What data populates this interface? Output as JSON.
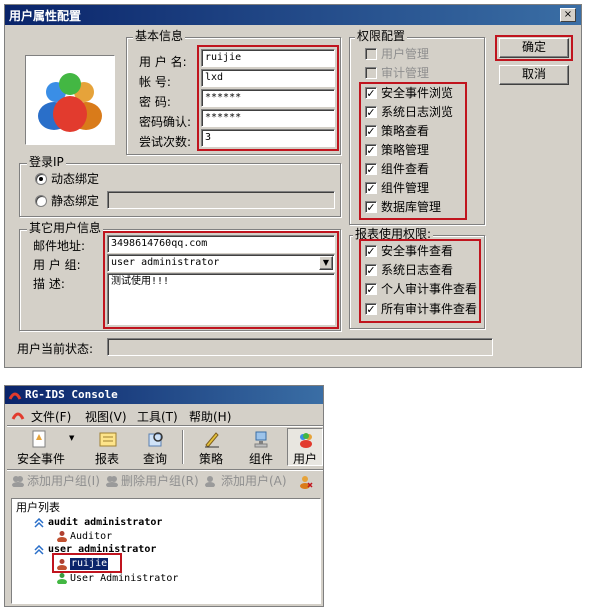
{
  "dialog": {
    "title": "用户属性配置",
    "close": "×",
    "basic_group": "基本信息",
    "fields": [
      {
        "label": "用 户 名:",
        "value": "ruijie"
      },
      {
        "label": "帐    号:",
        "value": "lxd"
      },
      {
        "label": "密    码:",
        "value": "******"
      },
      {
        "label": "密码确认:",
        "value": "******"
      },
      {
        "label": "尝试次数:",
        "value": "3"
      }
    ],
    "login_ip_group": "登录IP",
    "radio_dynamic": "动态绑定",
    "radio_static": "静态绑定",
    "other_group": "其它用户信息",
    "email_label": "邮件地址:",
    "email_value": "3498614760qq.com",
    "usergroup_label": "用 户 组:",
    "usergroup_value": "user administrator",
    "desc_label": "描    述:",
    "desc_value": "测试使用!!!",
    "status_label": "用户当前状态:",
    "status_value": "",
    "perm_group": "权限配置",
    "perms": [
      {
        "label": "用户管理",
        "checked": false,
        "disabled": true
      },
      {
        "label": "审计管理",
        "checked": false,
        "disabled": true
      },
      {
        "label": "安全事件浏览",
        "checked": true,
        "disabled": false
      },
      {
        "label": "系统日志浏览",
        "checked": true,
        "disabled": false
      },
      {
        "label": "策略查看",
        "checked": true,
        "disabled": false
      },
      {
        "label": "策略管理",
        "checked": true,
        "disabled": false
      },
      {
        "label": "组件查看",
        "checked": true,
        "disabled": false
      },
      {
        "label": "组件管理",
        "checked": true,
        "disabled": false
      },
      {
        "label": "数据库管理",
        "checked": true,
        "disabled": false
      }
    ],
    "report_group": "报表使用权限:",
    "reports": [
      {
        "label": "安全事件查看",
        "checked": true
      },
      {
        "label": "系统日志查看",
        "checked": true
      },
      {
        "label": "个人审计事件查看",
        "checked": true
      },
      {
        "label": "所有审计事件查看",
        "checked": true
      }
    ],
    "ok_label": "确定",
    "cancel_label": "取消",
    "check_mark": "✓"
  },
  "console": {
    "title": "RG-IDS Console",
    "menu": [
      "文件(F)",
      "视图(V)",
      "工具(T)",
      "帮助(H)"
    ],
    "toolbar": [
      "安全事件",
      "报表",
      "查询",
      "策略",
      "组件",
      "用户"
    ],
    "actions": [
      "添加用户组(I)",
      "删除用户组(R)",
      "添加用户(A)"
    ],
    "tree_header": "用户列表",
    "tree": [
      {
        "group": "audit administrator",
        "users": [
          "Auditor"
        ]
      },
      {
        "group": "user administrator",
        "users": [
          "ruijie",
          "User Administrator"
        ]
      }
    ]
  }
}
